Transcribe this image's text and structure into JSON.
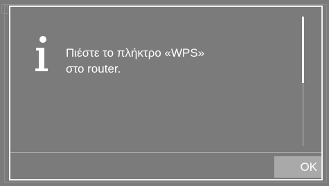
{
  "dialog": {
    "icon": "info-icon",
    "message_line1": "Πιέστε το πλήκτρο «WPS»",
    "message_line2": "στο router.",
    "ok_label": "OK"
  },
  "colors": {
    "background": "#7b7b7b",
    "foreground": "#ffffff",
    "button": "#a9a9a9"
  }
}
